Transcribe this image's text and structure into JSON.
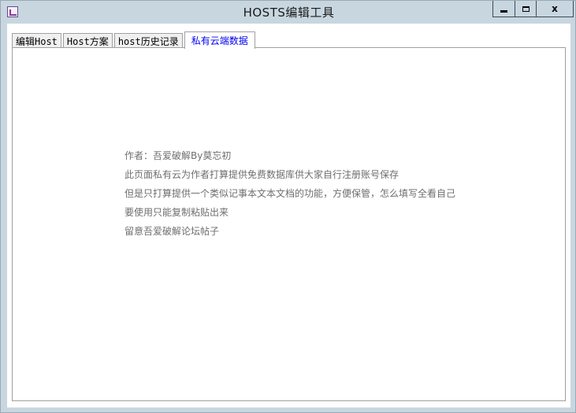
{
  "window": {
    "title": "HOSTS编辑工具",
    "close_label": "x"
  },
  "tabs": [
    {
      "label": "编辑Host"
    },
    {
      "label": "Host方案"
    },
    {
      "label": "host历史记录"
    },
    {
      "label": "私有云端数据",
      "active": true
    }
  ],
  "panel": {
    "lines": [
      "作者：吾爱破解By莫忘初",
      "此页面私有云为作者打算提供免费数据库供大家自行注册账号保存",
      "但是只打算提供一个类似记事本文本文档的功能，方便保管，怎么填写全看自己",
      "要使用只能复制粘贴出来",
      "留意吾爱破解论坛帖子"
    ]
  },
  "colors": {
    "active_tab_text": "#0000ee",
    "body_text": "#6e6e6e",
    "chrome": "#c8d6e0"
  }
}
